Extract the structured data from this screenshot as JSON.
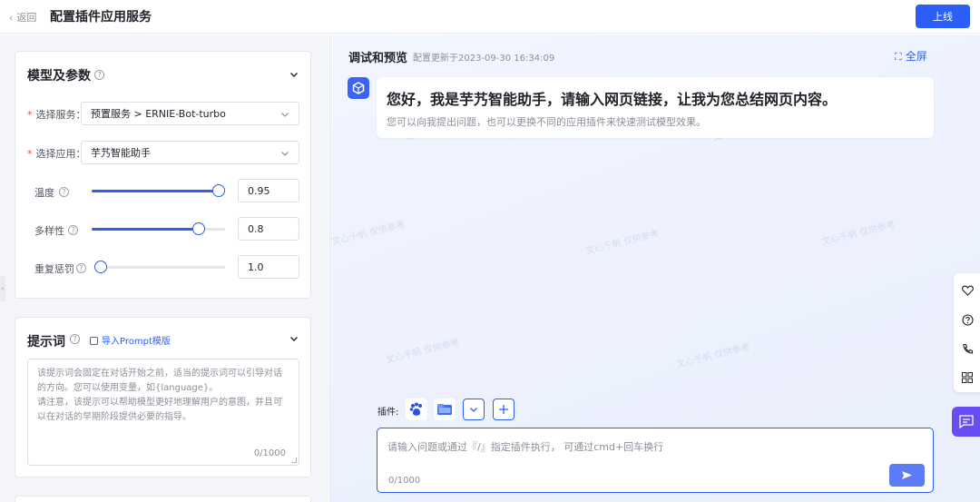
{
  "header": {
    "back_label": "返回",
    "title": "配置插件应用服务",
    "publish_label": "上线"
  },
  "params_card": {
    "title": "模型及参数",
    "service_label": "选择服务：",
    "service_value": "预置服务 > ERNIE-Bot-turbo",
    "app_label": "选择应用：",
    "app_value": "芋艿智能助手",
    "required_mark": "*",
    "temperature": {
      "label": "温度",
      "value": "0.95",
      "level": 0.95
    },
    "diversity": {
      "label": "多样性",
      "value": "0.8",
      "level": 0.8
    },
    "penalty": {
      "label": "重复惩罚",
      "value": "1.0",
      "level": 0.0
    }
  },
  "prompt_card": {
    "title": "提示词",
    "import_label": "导入Prompt模版",
    "placeholder_line1": "该提示词会固定在对话开始之前，适当的提示词可以引导对话",
    "placeholder_line2": "的方向。您可以使用变量，如{language}。",
    "placeholder_line3": "请注意，该提示可以帮助模型更好地理解用户的意图，并且可",
    "placeholder_line4": "以在对话的早期阶段提供必要的指导。",
    "count": "0/1000"
  },
  "debug_panel": {
    "title": "调试和预览",
    "updated": "配置更新于2023-09-30 16:34:09",
    "fullscreen_label": "全屏",
    "welcome_main": "您好，我是芋艿智能助手，请输入网页链接，让我为您总结网页内容。",
    "welcome_sub": "您可以向我提出问题，也可以更换不同的应用插件来快速测试模型效果。",
    "plugins_label": "插件:",
    "input_placeholder": "请输入问题或通过『/』指定插件执行， 可通过cmd+回车换行",
    "input_count": "0/1000"
  },
  "colors": {
    "primary": "#2b5ff7",
    "chat_float": "#6a4df2",
    "required": "#e34d59"
  },
  "icons": [
    "chevron-left-icon",
    "question-icon",
    "chevron-down-icon",
    "import-icon",
    "fullscreen-icon",
    "bot-logo-icon",
    "baidu-plugin-icon",
    "folder-plugin-icon",
    "plus-icon",
    "send-icon",
    "heart-icon",
    "help-icon",
    "phone-icon",
    "grid-icon",
    "chat-icon"
  ]
}
